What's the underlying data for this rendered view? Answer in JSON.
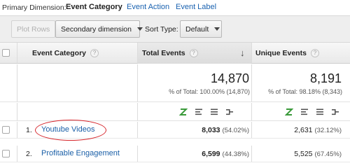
{
  "primary": {
    "label": "Primary Dimension:",
    "tabs": [
      {
        "label": "Event Category",
        "active": true
      },
      {
        "label": "Event Action",
        "active": false
      },
      {
        "label": "Event Label",
        "active": false
      }
    ]
  },
  "toolbar": {
    "plot_rows": "Plot Rows",
    "secondary_dimension": "Secondary dimension",
    "sort_type_label": "Sort Type:",
    "sort_type_value": "Default"
  },
  "table": {
    "headers": {
      "event_category": "Event Category",
      "total_events": "Total Events",
      "unique_events": "Unique Events",
      "help_glyph": "?"
    },
    "totals": {
      "total_events": "14,870",
      "total_events_sub": "% of Total: 100.00% (14,870)",
      "unique_events": "8,191",
      "unique_events_sub": "% of Total: 98.18% (8,343)"
    },
    "rows": [
      {
        "index": "1.",
        "category": "Youtube Videos",
        "total": "8,033",
        "total_pct": "(54.02%)",
        "unique": "2,631",
        "unique_pct": "(32.12%)"
      },
      {
        "index": "2.",
        "category": "Profitable Engagement",
        "total": "6,599",
        "total_pct": "(44.38%)",
        "unique": "5,525",
        "unique_pct": "(67.45%)"
      }
    ]
  },
  "colors": {
    "link": "#1a5fa7",
    "highlight_circle": "#d6252b",
    "viz_active": "#3a9a3a"
  },
  "viz_icons": [
    "data-table-icon",
    "percentage-icon",
    "performance-icon",
    "comparison-icon"
  ]
}
